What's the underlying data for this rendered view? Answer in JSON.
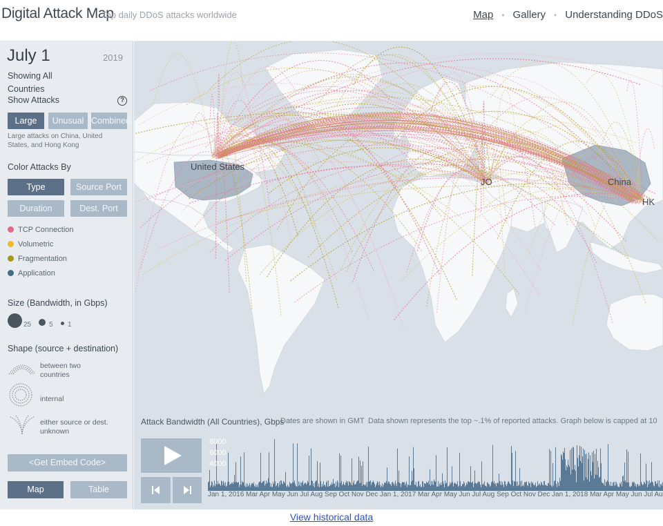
{
  "header": {
    "title": "Digital Attack Map",
    "subtitle": "Top daily DDoS attacks worldwide",
    "nav": [
      "Map",
      "Gallery",
      "Understanding DDoS"
    ]
  },
  "sidebar": {
    "date": "July 1",
    "year": "2019",
    "showing": "Showing All Countries",
    "show_attacks_label": "Show Attacks",
    "attack_buttons": [
      "Large",
      "Unusual",
      "Combined"
    ],
    "attack_description": "Large attacks on China, United States, and Hong Kong",
    "color_by_label": "Color Attacks By",
    "color_buttons": [
      "Type",
      "Source Port",
      "Duration",
      "Dest. Port"
    ],
    "legend": [
      {
        "label": "TCP Connection",
        "color": "#e06a8c"
      },
      {
        "label": "Volumetric",
        "color": "#f5b62a"
      },
      {
        "label": "Fragmentation",
        "color": "#a39a1e"
      },
      {
        "label": "Application",
        "color": "#3f6f87"
      }
    ],
    "size_label": "Size (Bandwidth, in Gbps)",
    "sizes": [
      "25",
      "5",
      "1"
    ],
    "shape_label": "Shape (source + destination)",
    "shapes": [
      "between two countries",
      "internal",
      "either source or dest. unknown"
    ],
    "embed_label": "<Get Embed Code>",
    "view_buttons": [
      "Map",
      "Table"
    ]
  },
  "map": {
    "labels": [
      "United States",
      "JO",
      "China",
      "HK"
    ],
    "land_color": "#f6f8fa",
    "ocean_color": "#d9e0e7",
    "highlight_color": "#a9b6c3",
    "arc_colors": [
      "#e8769a",
      "#b5a12a",
      "#f0b0c0",
      "#d2c46a"
    ]
  },
  "graph": {
    "title": "Attack Bandwidth (All Countries), Gbps",
    "gmt_note": "Dates are shown in GMT",
    "data_note": "Data shown represents the top ~.1% of reported attacks. Graph below is capped at 10",
    "yticks": [
      "8000",
      "6000",
      "4000"
    ],
    "xlabels": "Jan 1, 2016 Mar Apr May Jun Jul Aug Sep Oct Nov Dec Jan 1, 2017 Mar Apr May Jun Jul Aug Sep Oct Nov Dec Jan 1, 2018 Mar Apr May Jun Jul Aug Sep Oct Nov Dec Jan 1, 2019 Mar Apr May Jun Jul",
    "bar_color": "#5b7a96"
  },
  "footer": {
    "link": "View historical data"
  }
}
